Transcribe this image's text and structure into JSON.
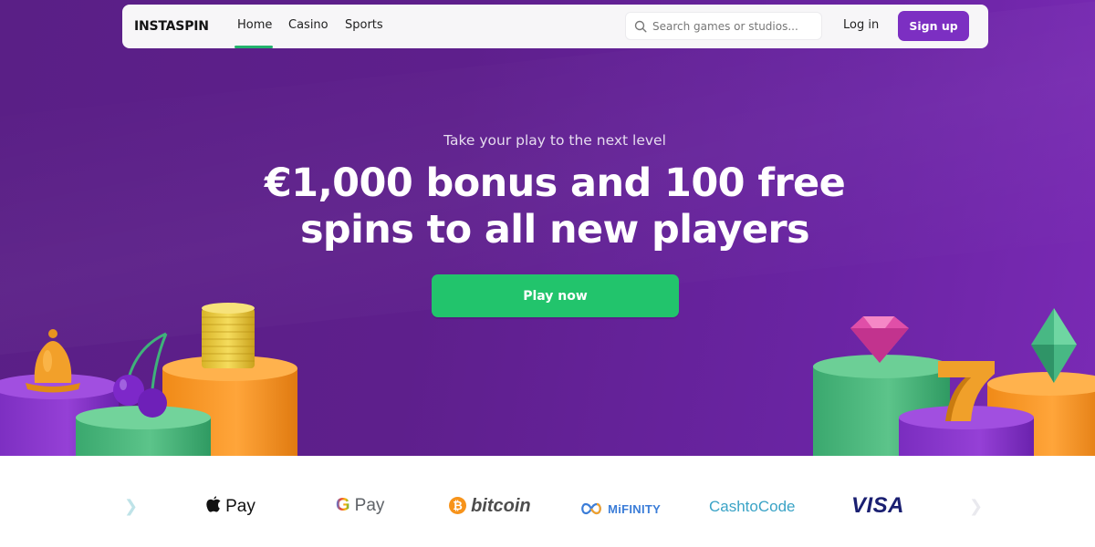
{
  "nav": {
    "logo": "INSTASPIN",
    "links": [
      {
        "label": "Home",
        "active": true
      },
      {
        "label": "Casino"
      },
      {
        "label": "Sports"
      }
    ],
    "search_placeholder": "Search games or studios...",
    "login_label": "Log in",
    "signup_label": "Sign up"
  },
  "hero": {
    "tagline": "Take your play to the next level",
    "headline_line1": "€1,000 bonus and 100 free",
    "headline_line2": "spins to all new players",
    "cta_label": "Play now"
  },
  "payments": {
    "methods": [
      {
        "name": "Apple Pay",
        "label": "Pay",
        "icon": "apple-icon"
      },
      {
        "name": "Google Pay",
        "label": "Pay",
        "icon": "google-g-icon"
      },
      {
        "name": "Bitcoin",
        "label": "bitcoin",
        "icon": "bitcoin-icon"
      },
      {
        "name": "MiFinity",
        "label": "MiFINITY",
        "icon": "infinity-icon"
      },
      {
        "name": "CashtoCode",
        "label": "CashtoCode"
      },
      {
        "name": "Visa",
        "label": "VISA"
      }
    ]
  },
  "colors": {
    "hero_bg": "#5e1f8c",
    "accent_purple": "#7c2fc2",
    "cta_green": "#22c46c",
    "nav_active_underline": "#23b26d"
  }
}
